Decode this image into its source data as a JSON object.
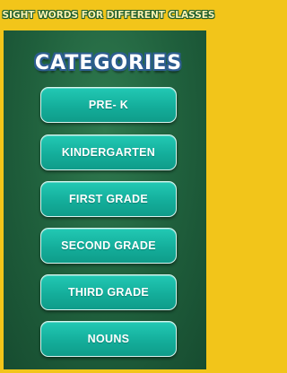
{
  "header": {
    "title": "SIGHT WORDS FOR DIFFERENT CLASSES"
  },
  "heading": "CATEGORIES",
  "categories": [
    {
      "label": "PRE- K"
    },
    {
      "label": "KINDERGARTEN"
    },
    {
      "label": "FIRST GRADE"
    },
    {
      "label": "SECOND GRADE"
    },
    {
      "label": "THIRD GRADE"
    },
    {
      "label": "NOUNS"
    }
  ],
  "colors": {
    "frame": "#f2c51a",
    "board": "#1f5f3c",
    "button": "#14ae9b",
    "heading_outline": "#2d5d8f"
  }
}
